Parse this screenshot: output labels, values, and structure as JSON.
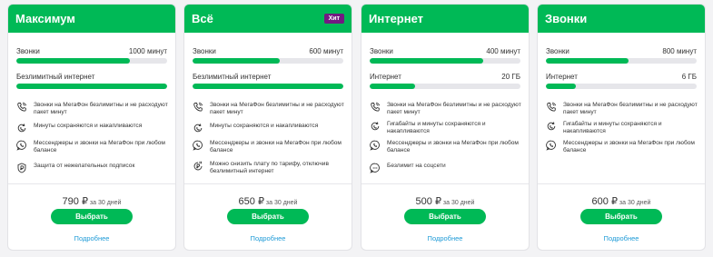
{
  "cards": [
    {
      "title": "Максимум",
      "badge": "",
      "calls": {
        "label": "Звонки",
        "value": "1000 минут",
        "fill": 0.75
      },
      "second": {
        "label": "Безлимитный интернет",
        "value": "",
        "fill": 1.0
      },
      "features": [
        {
          "icon": "unlimited-calls-icon",
          "text": "Звонки на МегаФон безлимитны и не расходуют пакет минут"
        },
        {
          "icon": "rollover-icon",
          "text": "Минуты сохраняются и накапливаются"
        },
        {
          "icon": "messenger-icon",
          "text": "Мессенджеры и звонки на МегаФон при любом балансе"
        },
        {
          "icon": "shield-icon",
          "text": "Защита от нежелательных подписок"
        }
      ],
      "price": "790 ₽",
      "period": " за 30 дней",
      "button": "Выбрать",
      "link": "Подробнее"
    },
    {
      "title": "Всё",
      "badge": "Хит",
      "calls": {
        "label": "Звонки",
        "value": "600 минут",
        "fill": 0.58
      },
      "second": {
        "label": "Безлимитный интернет",
        "value": "",
        "fill": 1.0
      },
      "features": [
        {
          "icon": "unlimited-calls-icon",
          "text": "Звонки на МегаФон безлимитны и не расходуют пакет минут"
        },
        {
          "icon": "rollover-icon",
          "text": "Минуты сохраняются и накапливаются"
        },
        {
          "icon": "messenger-icon",
          "text": "Мессенджеры и звонки на МегаФон при любом балансе"
        },
        {
          "icon": "ruble-pause-icon",
          "text": "Можно снизить плату по тарифу, отключив безлимитный интернет"
        }
      ],
      "price": "650 ₽",
      "period": " за 30 дней",
      "button": "Выбрать",
      "link": "Подробнее"
    },
    {
      "title": "Интернет",
      "badge": "",
      "calls": {
        "label": "Звонки",
        "value": "400 минут",
        "fill": 0.75
      },
      "second": {
        "label": "Интернет",
        "value": "20 ГБ",
        "fill": 0.3
      },
      "features": [
        {
          "icon": "unlimited-calls-icon",
          "text": "Звонки на МегаФон безлимитны и не расходуют пакет минут"
        },
        {
          "icon": "rollover-icon",
          "text": "Гигабайты и минуты сохраняются и накапливаются"
        },
        {
          "icon": "messenger-icon",
          "text": "Мессенджеры и звонки на МегаФон при любом балансе"
        },
        {
          "icon": "social-icon",
          "text": "Безлимит на соцсети"
        }
      ],
      "price": "500 ₽",
      "period": " за 30 дней",
      "button": "Выбрать",
      "link": "Подробнее"
    },
    {
      "title": "Звонки",
      "badge": "",
      "calls": {
        "label": "Звонки",
        "value": "800 минут",
        "fill": 0.55
      },
      "second": {
        "label": "Интернет",
        "value": "6 ГБ",
        "fill": 0.2
      },
      "features": [
        {
          "icon": "unlimited-calls-icon",
          "text": "Звонки на МегаФон безлимитны и не расходуют пакет минут"
        },
        {
          "icon": "rollover-icon",
          "text": "Гигабайты и минуты сохраняются и накапливаются"
        },
        {
          "icon": "messenger-icon",
          "text": "Мессенджеры и звонки на МегаФон при любом балансе"
        }
      ],
      "price": "600 ₽",
      "period": " за 30 дней",
      "button": "Выбрать",
      "link": "Подробнее"
    }
  ],
  "colors": {
    "brand": "#00b956",
    "badge": "#731982",
    "link": "#1f9bd7",
    "track": "#e6e6ea"
  }
}
